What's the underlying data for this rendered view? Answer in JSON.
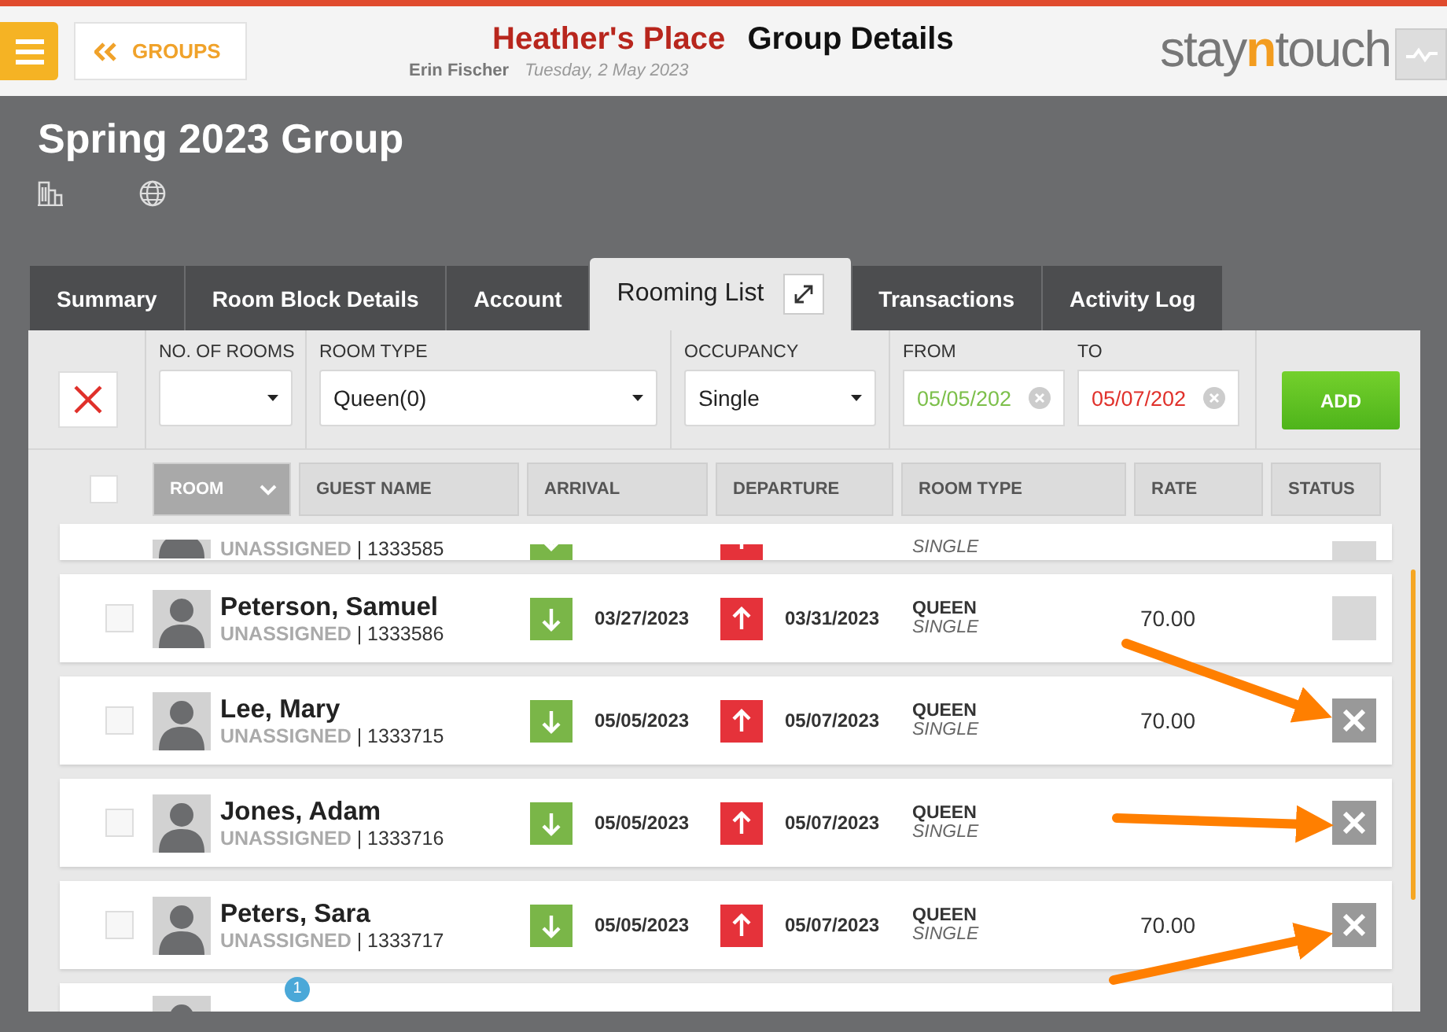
{
  "header": {
    "back_button": "GROUPS",
    "hotel": "Heather's Place",
    "page_title": "Group Details",
    "user": "Erin Fischer",
    "date": "Tuesday, 2 May 2023",
    "logo": [
      "stay",
      "n",
      "touch"
    ]
  },
  "group": {
    "name": "Spring 2023 Group"
  },
  "tabs": [
    {
      "label": "Summary",
      "selected": false
    },
    {
      "label": "Room Block Details",
      "selected": false
    },
    {
      "label": "Account",
      "selected": false
    },
    {
      "label": "Rooming List",
      "selected": true
    },
    {
      "label": "Transactions",
      "selected": false
    },
    {
      "label": "Activity Log",
      "selected": false
    }
  ],
  "filters": {
    "no_of_rooms": {
      "label": "NO. OF ROOMS"
    },
    "room_type": {
      "label": "ROOM TYPE",
      "value": "Queen(0)"
    },
    "occupancy": {
      "label": "OCCUPANCY",
      "value": "Single"
    },
    "from": {
      "label": "FROM",
      "value": "05/05/202"
    },
    "to": {
      "label": "TO",
      "value": "05/07/202"
    },
    "add_button": "ADD"
  },
  "select_all": {
    "checked": false
  },
  "columns": [
    "ROOM",
    "GUEST NAME",
    "ARRIVAL",
    "DEPARTURE",
    "ROOM TYPE",
    "RATE",
    "STATUS"
  ],
  "rows": [
    {
      "kind": "clipped_top",
      "info": "**UNASSIGNED** | 1333585",
      "occupancy": "SINGLE",
      "removable": false
    },
    {
      "kind": "full",
      "checked": false,
      "name": "Peterson, Samuel",
      "info": "**UNASSIGNED** | 1333586",
      "arrival": "03/27/2023",
      "departure": "03/31/2023",
      "room_type": "QUEEN",
      "occupancy": "SINGLE",
      "rate": "70.00",
      "removable": false
    },
    {
      "kind": "full",
      "checked": false,
      "name": "Lee, Mary",
      "info": "**UNASSIGNED** | 1333715",
      "arrival": "05/05/2023",
      "departure": "05/07/2023",
      "room_type": "QUEEN",
      "occupancy": "SINGLE",
      "rate": "70.00",
      "removable": true
    },
    {
      "kind": "full",
      "checked": false,
      "name": "Jones, Adam",
      "info": "**UNASSIGNED** | 1333716",
      "arrival": "05/05/2023",
      "departure": "05/07/2023",
      "room_type": "QUEEN",
      "occupancy": "SINGLE",
      "removable": true
    },
    {
      "kind": "full",
      "checked": false,
      "name": "Peters, Sara",
      "info": "**UNASSIGNED** | 1333717",
      "arrival": "05/05/2023",
      "departure": "05/07/2023",
      "room_type": "QUEEN",
      "occupancy": "SINGLE",
      "rate": "70.00",
      "removable": true
    },
    {
      "kind": "clipped_bottom",
      "badge": "1"
    }
  ]
}
